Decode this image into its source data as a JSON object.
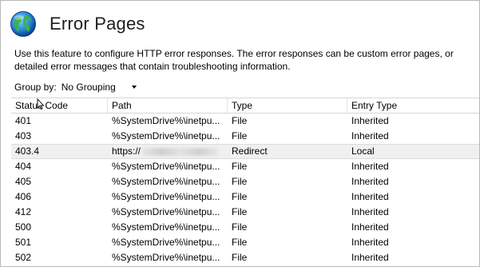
{
  "page": {
    "title": "Error Pages",
    "icon": "globe-icon",
    "description": "Use this feature to configure HTTP error responses. The error responses can be custom error pages, or detailed error messages that contain troubleshooting information."
  },
  "groupby": {
    "label": "Group by:",
    "value": "No Grouping"
  },
  "table": {
    "columns": [
      "Status Code",
      "Path",
      "Type",
      "Entry Type"
    ],
    "rows": [
      {
        "status": "401",
        "path": "%SystemDrive%\\inetpu...",
        "type": "File",
        "entry": "Inherited"
      },
      {
        "status": "403",
        "path": "%SystemDrive%\\inetpu...",
        "type": "File",
        "entry": "Inherited"
      },
      {
        "status": "403.4",
        "path": "https://",
        "type": "Redirect",
        "entry": "Local",
        "selected": true
      },
      {
        "status": "404",
        "path": "%SystemDrive%\\inetpu...",
        "type": "File",
        "entry": "Inherited"
      },
      {
        "status": "405",
        "path": "%SystemDrive%\\inetpu...",
        "type": "File",
        "entry": "Inherited"
      },
      {
        "status": "406",
        "path": "%SystemDrive%\\inetpu...",
        "type": "File",
        "entry": "Inherited"
      },
      {
        "status": "412",
        "path": "%SystemDrive%\\inetpu...",
        "type": "File",
        "entry": "Inherited"
      },
      {
        "status": "500",
        "path": "%SystemDrive%\\inetpu...",
        "type": "File",
        "entry": "Inherited"
      },
      {
        "status": "501",
        "path": "%SystemDrive%\\inetpu...",
        "type": "File",
        "entry": "Inherited"
      },
      {
        "status": "502",
        "path": "%SystemDrive%\\inetpu...",
        "type": "File",
        "entry": "Inherited"
      }
    ]
  }
}
